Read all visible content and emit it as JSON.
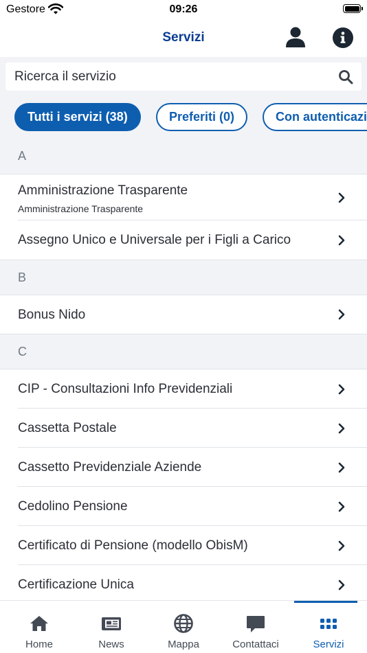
{
  "status": {
    "carrier": "Gestore",
    "time": "09:26"
  },
  "nav": {
    "title": "Servizi",
    "profile_icon": "user-icon",
    "info_icon": "info-icon"
  },
  "search": {
    "placeholder": "Ricerca il servizio",
    "value": ""
  },
  "filters": [
    {
      "label": "Tutti i servizi (38)",
      "active": true
    },
    {
      "label": "Preferiti (0)",
      "active": false
    },
    {
      "label": "Con autenticazione",
      "active": false
    }
  ],
  "sections": [
    {
      "letter": "A",
      "items": [
        {
          "title": "Amministrazione Trasparente",
          "subtitle": "Amministrazione Trasparente"
        },
        {
          "title": "Assegno Unico e Universale per i Figli a Carico"
        }
      ]
    },
    {
      "letter": "B",
      "items": [
        {
          "title": "Bonus Nido"
        }
      ]
    },
    {
      "letter": "C",
      "items": [
        {
          "title": "CIP - Consultazioni Info Previdenziali"
        },
        {
          "title": "Cassetta Postale"
        },
        {
          "title": "Cassetto Previdenziale Aziende"
        },
        {
          "title": "Cedolino Pensione"
        },
        {
          "title": "Certificato di Pensione (modello ObisM)"
        },
        {
          "title": "Certificazione Unica"
        }
      ]
    }
  ],
  "tabbar": [
    {
      "label": "Home",
      "icon": "home-icon",
      "active": false
    },
    {
      "label": "News",
      "icon": "newspaper-icon",
      "active": false
    },
    {
      "label": "Mappa",
      "icon": "globe-icon",
      "active": false
    },
    {
      "label": "Contattaci",
      "icon": "chat-bubble-icon",
      "active": false
    },
    {
      "label": "Servizi",
      "icon": "grid-icon",
      "active": true
    }
  ],
  "colors": {
    "accent": "#0e5eb0",
    "title": "#0b3d91",
    "section_bg": "#f2f3f6"
  }
}
